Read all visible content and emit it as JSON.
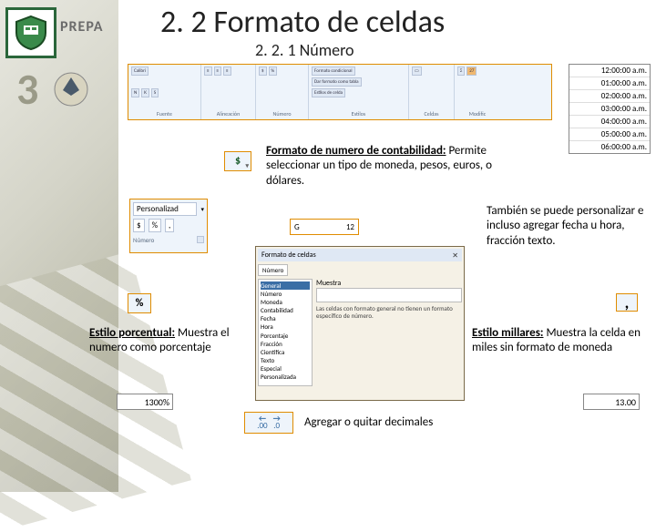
{
  "header": {
    "prepa": "PREPA",
    "number": "3",
    "title": "2. 2 Formato de celdas",
    "subtitle": "2. 2. 1 Número"
  },
  "ribbon": {
    "groups": {
      "font_label": "Fuente",
      "font_name": "Calibri",
      "align_label": "Alineación",
      "number_label": "Número",
      "styles_label": "Estilos",
      "style_cond": "Formato condicional",
      "style_table": "Dar formato como tabla",
      "style_cell": "Estilos de celda",
      "cells_label": "Celdas",
      "edit_label": "Modific"
    }
  },
  "times": [
    "12:00:00 a.m.",
    "01:00:00 a.m.",
    "02:00:00 a.m.",
    "03:00:00 a.m.",
    "04:00:00 a.m.",
    "05:00:00 a.m.",
    "06:00:00 a.m."
  ],
  "currency": {
    "symbol": "$",
    "title": "Formato de numero de contabilidad:",
    "desc": "Permite seleccionar un tipo de moneda, pesos, euros, o dólares."
  },
  "custom_pane": {
    "title": "Personalizad",
    "symbols": [
      "$",
      "%",
      ","
    ],
    "foot": "Número"
  },
  "general_box": {
    "left": "G",
    "right": "12"
  },
  "custom_text": "También se puede personalizar e incluso agregar fecha u hora, fracción texto.",
  "dialog": {
    "title": "Formato de celdas",
    "tab": "Número",
    "categories": [
      "General",
      "Número",
      "Moneda",
      "Contabilidad",
      "Fecha",
      "Hora",
      "Porcentaje",
      "Fracción",
      "Científica",
      "Texto",
      "Especial",
      "Personalizada"
    ],
    "sample_label": "Muestra",
    "desc": "Las celdas con formato general no tienen un formato específico de número."
  },
  "percent": {
    "icon": "%",
    "title": "Estilo porcentual:",
    "desc": "Muestra el numero como porcentaje",
    "sample": "1300%"
  },
  "comma_icon": ",",
  "miles": {
    "title": "Estilo millares:",
    "desc": "Muestra la celda en miles sin formato de moneda",
    "sample": "13.00"
  },
  "decimals": {
    "inc": ".00",
    "dec": ".0",
    "text": "Agregar o quitar decimales"
  }
}
